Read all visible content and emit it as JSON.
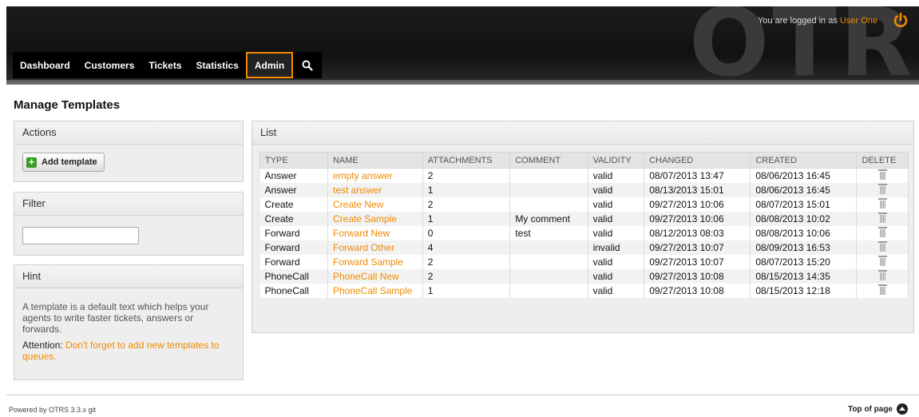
{
  "header": {
    "logo": "OTRS",
    "login_prefix": "You are logged in as",
    "user_name": "User One",
    "nav": [
      {
        "label": "Dashboard"
      },
      {
        "label": "Customers"
      },
      {
        "label": "Tickets"
      },
      {
        "label": "Statistics"
      },
      {
        "label": "Admin",
        "active": true
      }
    ]
  },
  "page_title": "Manage Templates",
  "sidebar": {
    "actions": {
      "title": "Actions",
      "add_label": "Add template"
    },
    "filter": {
      "title": "Filter",
      "value": ""
    },
    "hint": {
      "title": "Hint",
      "text": "A template is a default text which helps your agents to write faster tickets, answers or forwards.",
      "attention_label": "Attention:",
      "attention_text": "Don't forget to add new templates to queues."
    }
  },
  "list": {
    "title": "List",
    "columns": [
      "TYPE",
      "NAME",
      "ATTACHMENTS",
      "COMMENT",
      "VALIDITY",
      "CHANGED",
      "CREATED",
      "DELETE"
    ],
    "rows": [
      {
        "type": "Answer",
        "name": "empty answer",
        "attachments": "2",
        "comment": "",
        "validity": "valid",
        "changed": "08/07/2013 13:47",
        "created": "08/06/2013 16:45"
      },
      {
        "type": "Answer",
        "name": "test answer",
        "attachments": "1",
        "comment": "",
        "validity": "valid",
        "changed": "08/13/2013 15:01",
        "created": "08/06/2013 16:45"
      },
      {
        "type": "Create",
        "name": "Create New",
        "attachments": "2",
        "comment": "",
        "validity": "valid",
        "changed": "09/27/2013 10:06",
        "created": "08/07/2013 15:01"
      },
      {
        "type": "Create",
        "name": "Create Sample",
        "attachments": "1",
        "comment": "My comment",
        "validity": "valid",
        "changed": "09/27/2013 10:06",
        "created": "08/08/2013 10:02"
      },
      {
        "type": "Forward",
        "name": "Forward New",
        "attachments": "0",
        "comment": "test",
        "validity": "valid",
        "changed": "08/12/2013 08:03",
        "created": "08/08/2013 10:06"
      },
      {
        "type": "Forward",
        "name": "Forward Other",
        "attachments": "4",
        "comment": "",
        "validity": "invalid",
        "changed": "09/27/2013 10:07",
        "created": "08/09/2013 16:53"
      },
      {
        "type": "Forward",
        "name": "Forward Sample",
        "attachments": "2",
        "comment": "",
        "validity": "valid",
        "changed": "09/27/2013 10:07",
        "created": "08/07/2013 15:20"
      },
      {
        "type": "PhoneCall",
        "name": "PhoneCall New",
        "attachments": "2",
        "comment": "",
        "validity": "valid",
        "changed": "09/27/2013 10:08",
        "created": "08/15/2013 14:35"
      },
      {
        "type": "PhoneCall",
        "name": "PhoneCall Sample",
        "attachments": "1",
        "comment": "",
        "validity": "valid",
        "changed": "09/27/2013 10:08",
        "created": "08/15/2013 12:18"
      }
    ]
  },
  "footer": {
    "powered_by": "Powered by OTRS 3.3.x git",
    "top_of_page": "Top of page"
  },
  "colors": {
    "accent": "#f08a00",
    "header_bg": "#111111"
  }
}
